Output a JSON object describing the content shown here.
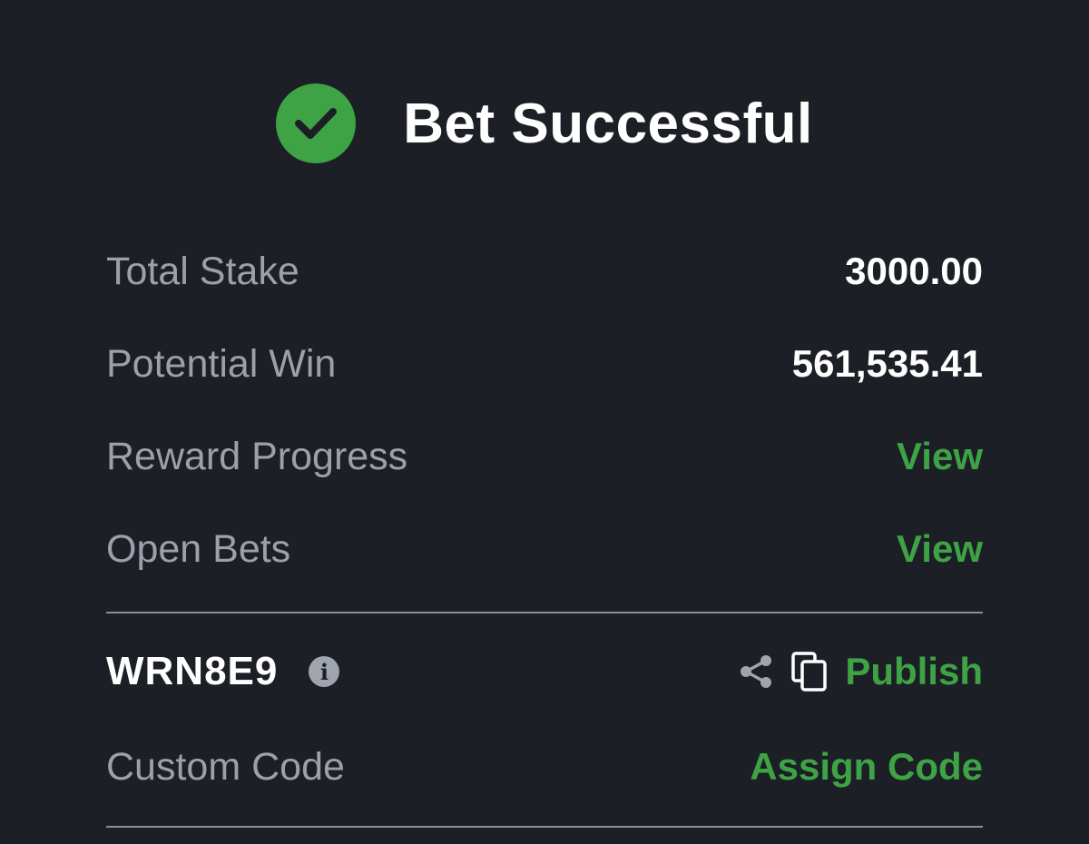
{
  "header": {
    "title": "Bet Successful",
    "icon": "check-circle-icon",
    "accent_color": "#3ea344"
  },
  "summary": {
    "total_stake_label": "Total Stake",
    "total_stake_value": "3000.00",
    "potential_win_label": "Potential Win",
    "potential_win_value": "561,535.41",
    "reward_progress_label": "Reward Progress",
    "reward_progress_link": "View",
    "open_bets_label": "Open Bets",
    "open_bets_link": "View"
  },
  "booking": {
    "code": "WRN8E9",
    "info_icon": "info-icon",
    "share_icon": "share-icon",
    "copy_icon": "copy-icon",
    "publish_label": "Publish",
    "custom_code_label": "Custom Code",
    "assign_code_label": "Assign Code"
  }
}
